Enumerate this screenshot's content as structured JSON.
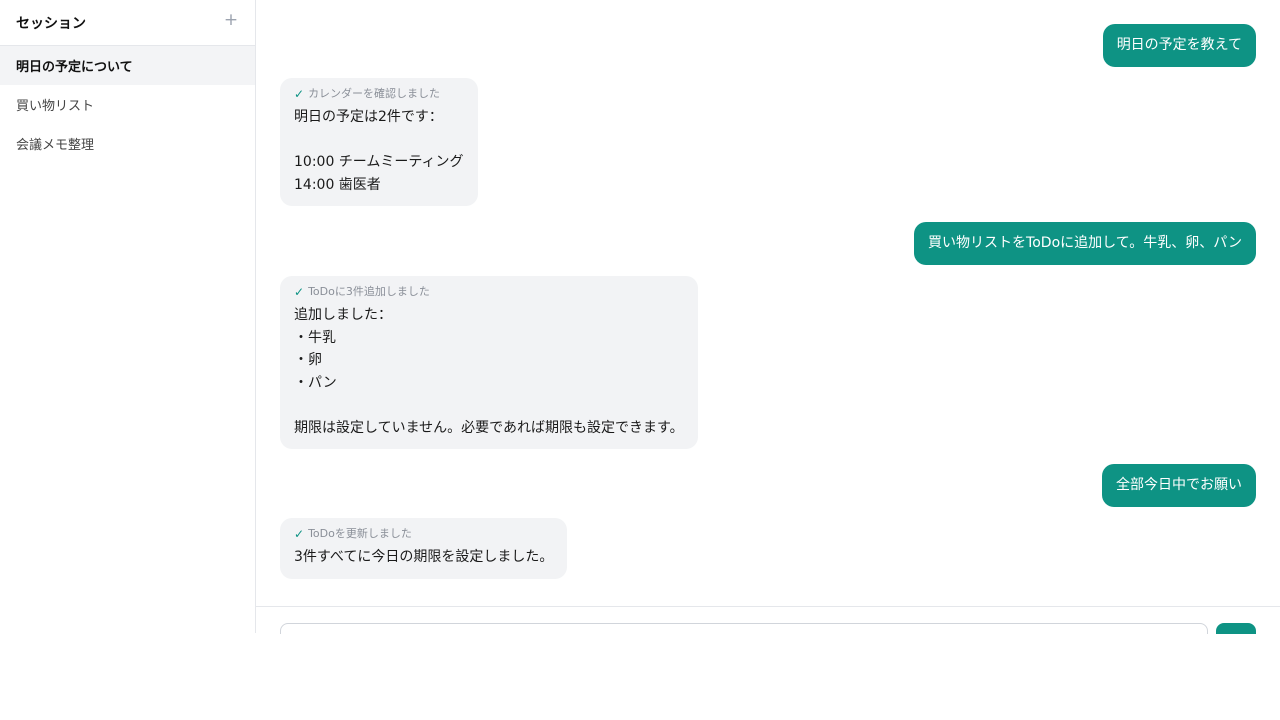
{
  "sidebar": {
    "title": "セッション",
    "add_icon": "plus-icon",
    "sessions": [
      {
        "label": "明日の予定について",
        "active": true
      },
      {
        "label": "買い物リスト",
        "active": false
      },
      {
        "label": "会議メモ整理",
        "active": false
      }
    ]
  },
  "messages": [
    {
      "role": "user",
      "text": "明日の予定を教えて"
    },
    {
      "role": "assistant",
      "tool": "カレンダーを確認しました",
      "text": "明日の予定は2件です：\n\n10:00  チームミーティング\n14:00  歯医者"
    },
    {
      "role": "user",
      "text": "買い物リストをToDoに追加して。牛乳、卵、パン"
    },
    {
      "role": "assistant",
      "tool": "ToDoに3件追加しました",
      "text": "追加しました：\n・牛乳\n・卵\n・パン\n\n期限は設定していません。必要であれば期限も設定できます。"
    },
    {
      "role": "user",
      "text": "全部今日中でお願い"
    },
    {
      "role": "assistant",
      "tool": "ToDoを更新しました",
      "text": "3件すべてに今日の期限を設定しました。"
    }
  ],
  "composer": {
    "placeholder": "",
    "value": ""
  },
  "colors": {
    "accent": "#0e9384",
    "assistant_bubble": "#f2f3f5",
    "border": "#e5e7eb"
  }
}
